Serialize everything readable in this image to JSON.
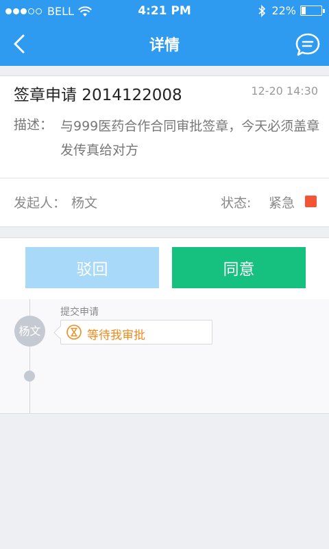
{
  "status_bar": {
    "carrier": "BELL",
    "time": "4:21 PM",
    "battery_text": "22%",
    "battery_level": 0.22,
    "icons": [
      "signal-dots",
      "wifi-icon",
      "bluetooth-icon",
      "battery-icon"
    ]
  },
  "nav": {
    "title": "详情",
    "back_icon": "chevron-left-icon",
    "chat_icon": "chat-bubble-icon"
  },
  "request": {
    "title": "签章申请 2014122008",
    "time": "12-20  14:30",
    "description_label": "描述：",
    "description": "与999医药合作合同审批签章，今天必须盖章发传真给对方",
    "starter_label": "发起人：",
    "starter_name": "杨文",
    "state_label": "状态:",
    "state_value": "紧急",
    "state_color": "#f25434"
  },
  "actions": {
    "reject_label": "驳回",
    "agree_label": "同意",
    "reject_color": "#a8d9f8",
    "agree_color": "#16c07f"
  },
  "timeline": {
    "step_label": "提交申请",
    "avatar_text": "杨文",
    "status_text": "等待我审批",
    "status_icon": "hourglass-icon",
    "status_color": "#f08a1c"
  },
  "colors": {
    "accent": "#2e9bf0",
    "background": "#eeeff3"
  }
}
